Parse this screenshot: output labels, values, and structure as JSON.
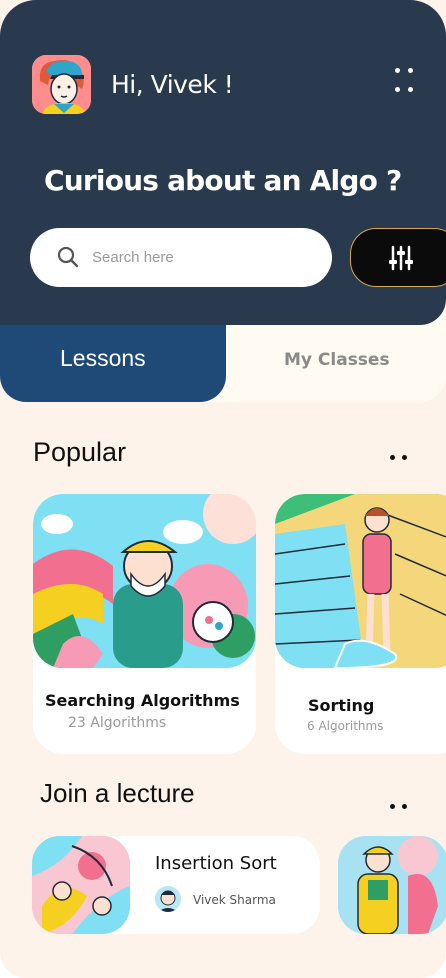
{
  "header": {
    "greeting": "Hi, Vivek !",
    "headline": "Curious about an Algo ?",
    "avatar_icon": "user-avatar",
    "menu_icon": "four-dots-icon"
  },
  "search": {
    "placeholder": "Search here",
    "value": "",
    "icon": "search-icon",
    "filter_icon": "sliders-icon"
  },
  "tabs": [
    {
      "label": "Lessons",
      "active": true
    },
    {
      "label": "My Classes",
      "active": false
    }
  ],
  "popular": {
    "title": "Popular",
    "cards": [
      {
        "title": "Searching Algorithms",
        "subtitle": "23 Algorithms"
      },
      {
        "title": "Sorting",
        "subtitle": "6 Algorithms"
      }
    ]
  },
  "lectures": {
    "title": "Join a lecture",
    "items": [
      {
        "title": "Insertion Sort",
        "tutor": "Vivek Sharma"
      }
    ]
  },
  "colors": {
    "header_bg": "#2a3a4e",
    "active_tab": "#1f4a78",
    "page_bg": "#fdf3ea"
  }
}
